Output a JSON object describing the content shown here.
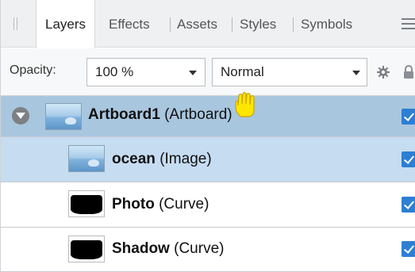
{
  "tabs": [
    {
      "label": "Layers",
      "active": true
    },
    {
      "label": "Effects",
      "active": false
    },
    {
      "label": "Assets",
      "active": false
    },
    {
      "label": "Styles",
      "active": false
    },
    {
      "label": "Symbols",
      "active": false
    }
  ],
  "toolbar": {
    "opacity_label": "Opacity:",
    "opacity_value": "100 %",
    "blend_mode": "Normal"
  },
  "layers": [
    {
      "name": "Artboard1",
      "type": " (Artboard)",
      "visible": true,
      "thumb": "landscape-icon"
    },
    {
      "name": "ocean",
      "type": " (Image)",
      "visible": true,
      "thumb": "landscape-icon"
    },
    {
      "name": "Photo",
      "type": " (Curve)",
      "visible": true,
      "thumb": "black-shape-icon"
    },
    {
      "name": "Shadow",
      "type": " (Curve)",
      "visible": true,
      "thumb": "black-shape-icon"
    }
  ],
  "colors": {
    "artboard_row": "#a9c6df",
    "selected_row": "#c6dcf1",
    "checkbox": "#2d7fd3",
    "cursor": "#ffe600"
  }
}
